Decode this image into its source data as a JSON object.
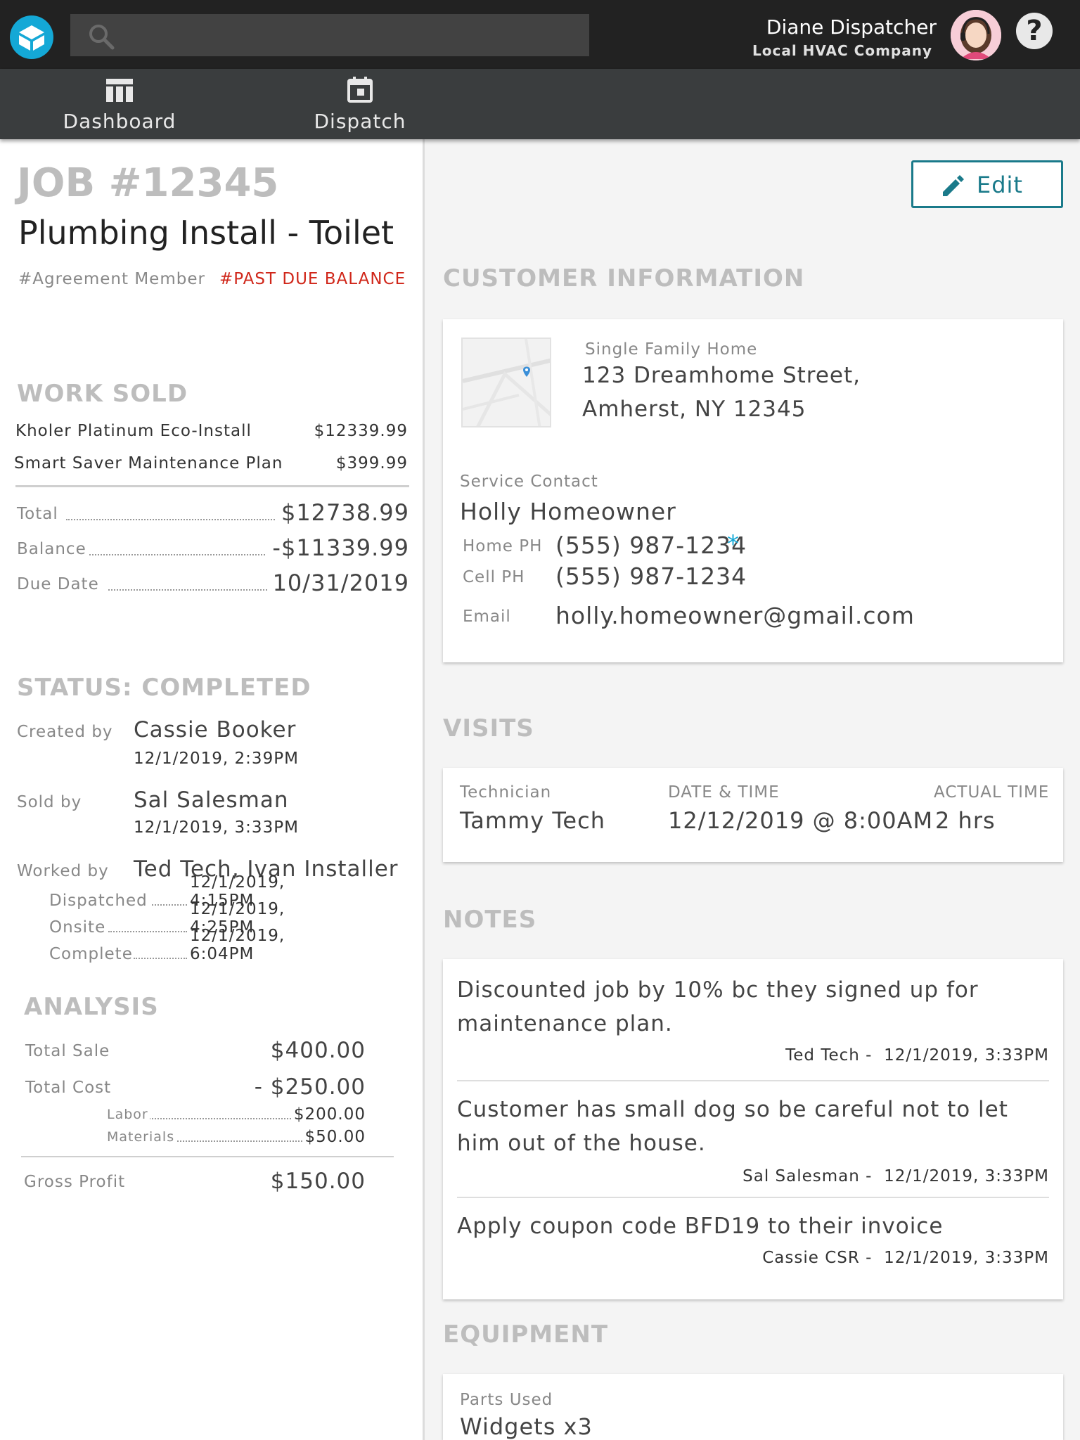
{
  "header": {
    "logo_icon": "company-logo-icon",
    "search_placeholder": "",
    "user_name": "Diane Dispatcher",
    "user_company": "Local HVAC Company",
    "help_label": "?"
  },
  "nav": {
    "tabs": [
      {
        "label": "Dashboard",
        "icon": "dashboard-icon"
      },
      {
        "label": "Dispatch",
        "icon": "calendar-icon"
      }
    ]
  },
  "job": {
    "number": "JOB #12345",
    "title": "Plumbing Install - Toilet",
    "tags": [
      "#Agreement Member",
      "#PAST DUE BALANCE"
    ]
  },
  "work_sold": {
    "heading": "WORK SOLD",
    "items": [
      {
        "name": "Kholer Platinum Eco-Install",
        "amount": "$12339.99"
      },
      {
        "name": "Smart Saver Maintenance Plan",
        "amount": "$399.99"
      }
    ],
    "total_label": "Total",
    "total": "$12738.99",
    "balance_label": "Balance",
    "balance": "-$11339.99",
    "due_label": "Due Date",
    "due": "10/31/2019"
  },
  "status": {
    "heading": "STATUS: COMPLETED",
    "created_label": "Created by",
    "created_name": "Cassie Booker",
    "created_time": "12/1/2019, 2:39PM",
    "sold_label": "Sold by",
    "sold_name": "Sal Salesman",
    "sold_time": "12/1/2019, 3:33PM",
    "worked_label": "Worked by",
    "worked_names": "Ted Tech, Ivan Installer",
    "steps": [
      {
        "label": "Dispatched",
        "time": "12/1/2019, 4:15PM"
      },
      {
        "label": "Onsite",
        "time": "12/1/2019, 4:25PM"
      },
      {
        "label": "Complete",
        "time": "12/1/2019, 6:04PM"
      }
    ]
  },
  "analysis": {
    "heading": "ANALYSIS",
    "total_sale_label": "Total Sale",
    "total_sale": "$400.00",
    "total_cost_label": "Total Cost",
    "total_cost": "- $250.00",
    "labor_label": "Labor",
    "labor": "$200.00",
    "materials_label": "Materials",
    "materials": "$50.00",
    "gross_profit_label": "Gross Profit",
    "gross_profit": "$150.00"
  },
  "edit_button": {
    "label": "Edit",
    "icon": "pencil-icon"
  },
  "customer": {
    "heading": "CUSTOMER INFORMATION",
    "map_icon": "map-pin-icon",
    "property_type": "Single Family Home",
    "address_line1": "123 Dreamhome Street,",
    "address_line2": "Amherst, NY 12345",
    "service_contact_label": "Service Contact",
    "contact_name": "Holly Homeowner",
    "home_ph_label": "Home PH",
    "home_ph": "(555) 987-1234",
    "primary_marker": "*",
    "cell_ph_label": "Cell PH",
    "cell_ph": "(555) 987-1234",
    "email_label": "Email",
    "email": "holly.homeowner@gmail.com"
  },
  "visits": {
    "heading": "VISITS",
    "technician_label": "Technician",
    "technician": "Tammy Tech",
    "datetime_label": "DATE & TIME",
    "datetime": "12/12/2019 @ 8:00AM",
    "actual_label": "ACTUAL TIME",
    "actual": "2 hrs"
  },
  "notes": {
    "heading": "NOTES",
    "items": [
      {
        "text": "Discounted job by 10% bc they signed up for maintenance plan.",
        "author": "Ted Tech -",
        "time": "12/1/2019, 3:33PM"
      },
      {
        "text": "Customer has small dog so be careful not to let him out of the house.",
        "author": "Sal Salesman -",
        "time": "12/1/2019, 3:33PM"
      },
      {
        "text": "Apply coupon code BFD19 to their invoice",
        "author": "Cassie CSR -",
        "time": "12/1/2019, 3:33PM"
      }
    ]
  },
  "equipment": {
    "heading": "EQUIPMENT",
    "parts_label": "Parts Used",
    "parts": "Widgets x3"
  }
}
